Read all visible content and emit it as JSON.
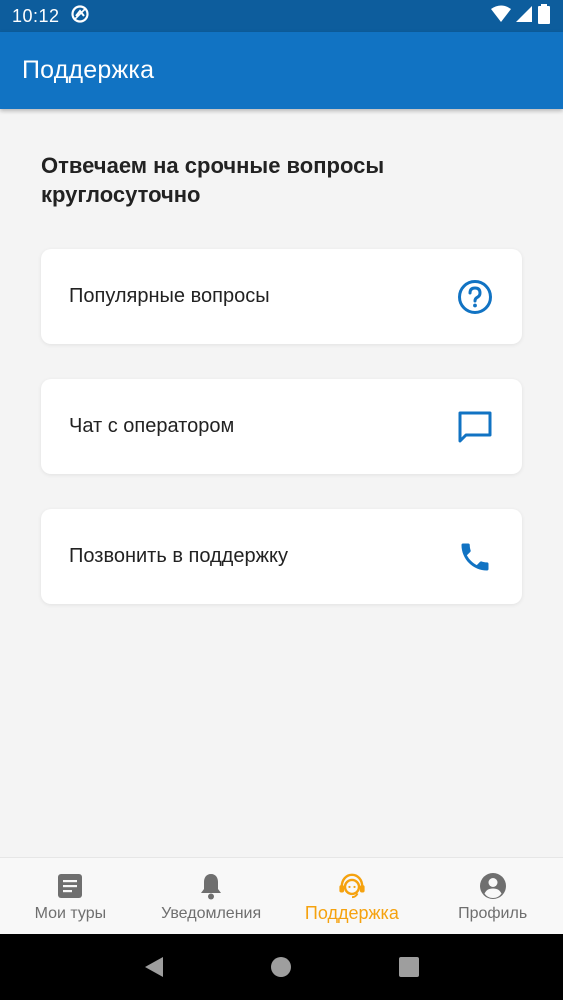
{
  "status_bar": {
    "time": "10:12",
    "icons": [
      "notification-icon",
      "wifi-icon",
      "signal-icon",
      "battery-icon"
    ]
  },
  "app_bar": {
    "title": "Поддержка"
  },
  "main": {
    "headline": "Отвечаем на срочные вопросы круглосуточно",
    "cards": [
      {
        "label": "Популярные вопросы",
        "icon": "help-circle-icon"
      },
      {
        "label": "Чат с оператором",
        "icon": "chat-icon"
      },
      {
        "label": "Позвонить в поддержку",
        "icon": "phone-icon"
      }
    ]
  },
  "bottom_nav": {
    "items": [
      {
        "label": "Мои туры",
        "icon": "document-icon",
        "active": false
      },
      {
        "label": "Уведомления",
        "icon": "bell-icon",
        "active": false
      },
      {
        "label": "Поддержка",
        "icon": "support-agent-icon",
        "active": true
      },
      {
        "label": "Профиль",
        "icon": "account-icon",
        "active": false
      }
    ]
  },
  "colors": {
    "status_bar": "#0d5d9d",
    "app_bar": "#1173c3",
    "accent_blue": "#1173c3",
    "active_tab": "#f5a20f",
    "inactive_tab": "#6f6f6f",
    "background": "#f4f4f4"
  }
}
